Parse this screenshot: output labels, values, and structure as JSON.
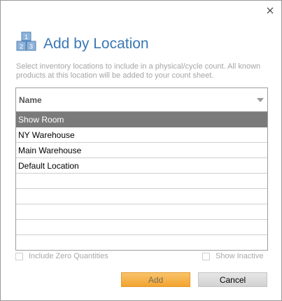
{
  "dialog": {
    "title": "Add by Location",
    "description": "Select inventory locations to include in a physical/cycle count.  All known products at this location will be added to your count sheet.",
    "header_icon": "inventory-boxes-icon",
    "accent_color": "#3b78b4"
  },
  "grid": {
    "column_header": "Name",
    "rows": [
      "Show Room",
      "NY Warehouse",
      "Main Warehouse",
      "Default Location"
    ],
    "selected_row": "Show Room"
  },
  "options": {
    "include_zero_label": "Include Zero Quantities",
    "include_zero_checked": false,
    "show_inactive_label": "Show Inactive",
    "show_inactive_checked": false
  },
  "buttons": {
    "add_label": "Add",
    "cancel_label": "Cancel"
  }
}
